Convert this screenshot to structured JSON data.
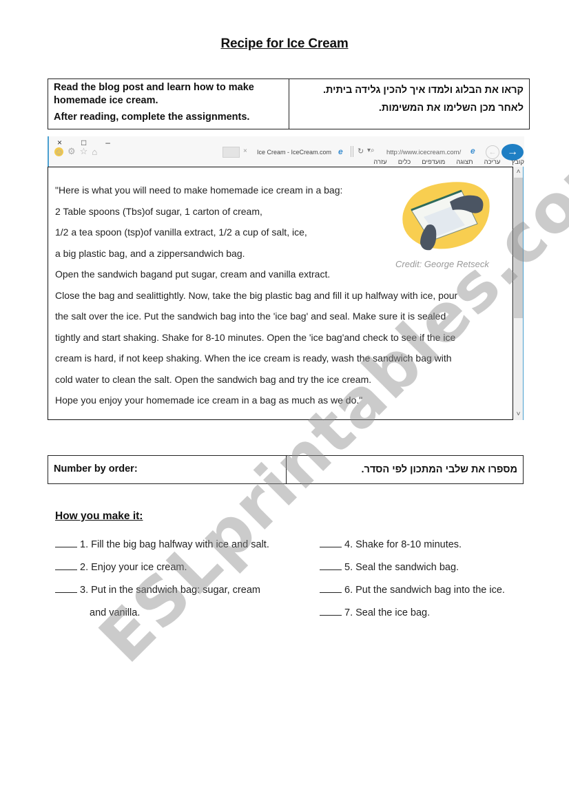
{
  "title": "Recipe for Ice Cream",
  "instructions": {
    "en_line1": "Read the blog post and learn how to make homemade ice cream.",
    "en_line2": "After reading, complete the assignments.",
    "he_line1": "קראו את הבלוג ולמדו איך להכין גלידה ביתית.",
    "he_line2": "לאחר מכן השלימו את המשימות."
  },
  "browser": {
    "window_controls": [
      "×",
      "□",
      "–"
    ],
    "icons": [
      "smiley-icon",
      "gear-icon",
      "star-icon",
      "home-icon"
    ],
    "tab_close": "×",
    "tab_title": "Ice Cream - IceCream.com",
    "url": "http://www.icecream.com/",
    "back_glyph": "←",
    "forward_glyph": "→",
    "menu": [
      "קובץ",
      "עריכה",
      "תצוגה",
      "מועדפים",
      "כלים",
      "עזרה"
    ],
    "scroll_up": "︿",
    "scroll_down": "﹀",
    "scroll_position": 0.0,
    "accent_color": "#1f7fc4"
  },
  "blog": {
    "lines": [
      "\"Here is what you will need to make homemade ice cream in a bag:",
      " 2 Table spoons (Tbs)of sugar, 1 carton of cream,",
      "1/2 a tea spoon (tsp)of vanilla extract, 1/2 a cup of salt, ice,",
      "a big plastic bag, and a zippersandwich bag.",
      "Open the sandwich bagand put sugar, cream and vanilla extract.",
      "Close the bag and sealittightly. Now, take the big plastic bag and fill it up halfway with ice, pour",
      "the salt over the ice. Put the sandwich bag into the 'ice bag' and seal. Make sure it is sealed",
      "tightly and start shaking. Shake for 8-10 minutes. Open the 'ice bag'and check to see if the ice",
      "cream is hard, if not keep shaking. When the ice cream is ready, wash the sandwich bag with",
      "cold water to clean the salt. Open the sandwich bag and try the ice cream.",
      "Hope you enjoy your homemade ice cream in a bag as much as we do.\""
    ],
    "image_credit": "Credit: George Retseck"
  },
  "order_table": {
    "en": "Number by order:",
    "he": "מספרו את שלבי המתכון לפי הסדר."
  },
  "howto": {
    "heading": "How you make it:",
    "left_steps": [
      "1. Fill the big bag halfway with ice and salt.",
      "2. Enjoy your ice cream.",
      "3. Put in the sandwich bag: sugar, cream"
    ],
    "left_continuation": "and vanilla.",
    "right_steps": [
      "4. Shake for 8-10 minutes.",
      "5. Seal the sandwich bag.",
      "6. Put the sandwich bag into the ice.",
      "7. Seal the ice bag."
    ]
  },
  "watermark": "ESLprintables.com"
}
